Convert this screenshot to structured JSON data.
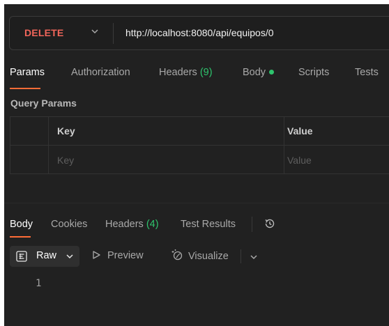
{
  "request": {
    "method": "DELETE",
    "url": "http://localhost:8080/api/equipos/0"
  },
  "request_tabs": [
    {
      "label": "Params",
      "active": true
    },
    {
      "label": "Authorization"
    },
    {
      "label": "Headers",
      "count": "(9)"
    },
    {
      "label": "Body",
      "indicator": "green-dot"
    },
    {
      "label": "Scripts"
    },
    {
      "label": "Tests"
    }
  ],
  "query_params": {
    "title": "Query Params",
    "columns": {
      "key": "Key",
      "value": "Value"
    },
    "placeholders": {
      "key": "Key",
      "value": "Value"
    }
  },
  "response_tabs": [
    {
      "label": "Body",
      "active": true
    },
    {
      "label": "Cookies"
    },
    {
      "label": "Headers",
      "count": "(4)"
    },
    {
      "label": "Test Results"
    }
  ],
  "response_toolbar": {
    "format": "Raw",
    "preview": "Preview",
    "visualize": "Visualize"
  },
  "editor": {
    "line_numbers": [
      "1"
    ]
  },
  "colors": {
    "background": "#212121",
    "method_delete": "#f0655a",
    "accent": "#ff6c37",
    "count_green": "#2ec46d"
  },
  "icons": [
    "chevron-down-icon",
    "history-icon",
    "raw-format-icon",
    "play-icon",
    "visualize-icon"
  ]
}
